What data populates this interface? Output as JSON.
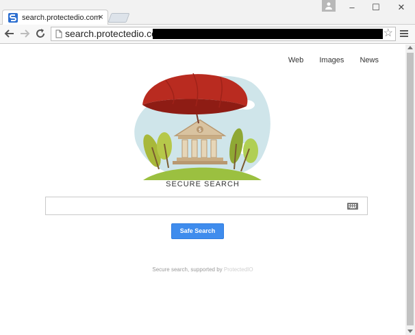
{
  "browser": {
    "tab_title": "search.protectedio.com",
    "tab_close": "×",
    "window": {
      "minimize": "–",
      "maximize": "☐",
      "close": "✕"
    },
    "url": "search.protectedio.con",
    "star": "☆"
  },
  "page": {
    "nav": [
      {
        "label": "Web"
      },
      {
        "label": "Images"
      },
      {
        "label": "News"
      }
    ],
    "hero_sign": "$",
    "brand_title": "SECURE SEARCH",
    "search": {
      "value": "",
      "placeholder": ""
    },
    "search_button_label": "Safe Search",
    "footer_text": "Secure search, supported by ",
    "footer_brand": "ProtectedIO"
  },
  "colors": {
    "umbrella": "#b92b20",
    "primary_button": "#3f8ced",
    "tree": "#8fb13a",
    "sky": "#cfe5ea"
  }
}
